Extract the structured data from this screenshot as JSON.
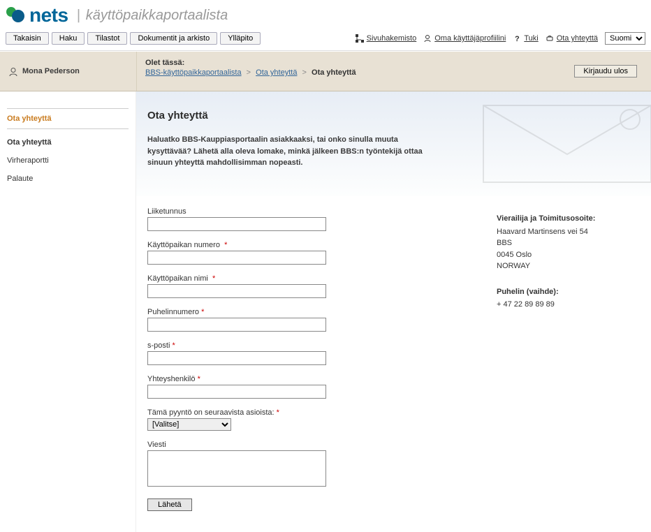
{
  "brand": {
    "name": "nets",
    "subtitle": "käyttöpaikkaportaalista"
  },
  "toolbar": {
    "items": [
      {
        "id": "back",
        "label": "Takaisin"
      },
      {
        "id": "search",
        "label": "Haku"
      },
      {
        "id": "stats",
        "label": "Tilastot"
      },
      {
        "id": "docs",
        "label": "Dokumentit ja arkisto"
      },
      {
        "id": "maint",
        "label": "Ylläpito"
      }
    ]
  },
  "utilities": {
    "sitemap": "Sivuhakemisto",
    "profile": "Oma käyttäjäprofiilini",
    "help": "Tuki",
    "contact": "Ota yhteyttä",
    "language_selected": "Suomi"
  },
  "user": {
    "name": "Mona Pederson"
  },
  "breadcrumb": {
    "label": "Olet tässä:",
    "items": [
      {
        "label": "BBS-käyttöpaikkaportaalista",
        "link": true
      },
      {
        "label": "Ota yhteyttä",
        "link": true
      },
      {
        "label": "Ota yhteyttä",
        "link": false
      }
    ]
  },
  "logout": "Kirjaudu ulos",
  "sidebar": {
    "section_title": "Ota yhteyttä",
    "items": [
      {
        "label": "Ota yhteyttä",
        "bold": true
      },
      {
        "label": "Virheraportti",
        "bold": false
      },
      {
        "label": "Palaute",
        "bold": false
      }
    ]
  },
  "page": {
    "title": "Ota yhteyttä",
    "intro": "Haluatko BBS-Kauppiasportaalin asiakkaaksi, tai onko sinulla muuta kysyttävää? Lähetä alla oleva lomake, minkä jälkeen BBS:n työntekijä ottaa sinuun yhteyttä mahdollisimman nopeasti."
  },
  "form": {
    "liiketunnus": {
      "label": "Liiketunnus",
      "value": ""
    },
    "kayttopaikan_numero": {
      "label": "Käyttöpaikan numero",
      "value": ""
    },
    "kayttopaikan_nimi": {
      "label": "Käyttöpaikan nimi",
      "value": ""
    },
    "puhelinnumero": {
      "label": "Puhelinnumero",
      "value": ""
    },
    "sposti": {
      "label": "s-posti",
      "value": ""
    },
    "yhteyshenkilo": {
      "label": "Yhteyshenkilö",
      "value": ""
    },
    "asia": {
      "label": "Tämä pyyntö on seuraavista asioista:",
      "selected": "[Valitse]"
    },
    "viesti": {
      "label": "Viesti",
      "value": ""
    },
    "submit": "Lähetä",
    "required_mark": "*"
  },
  "info": {
    "address_title": "Vierailija ja Toimitusosoite:",
    "address_line1": "Haavard Martinsens vei 54",
    "address_line2": "BBS",
    "address_line3": "0045 Oslo",
    "address_line4": "NORWAY",
    "phone_title": "Puhelin (vaihde):",
    "phone_value": "+ 47 22 89 89 89"
  }
}
